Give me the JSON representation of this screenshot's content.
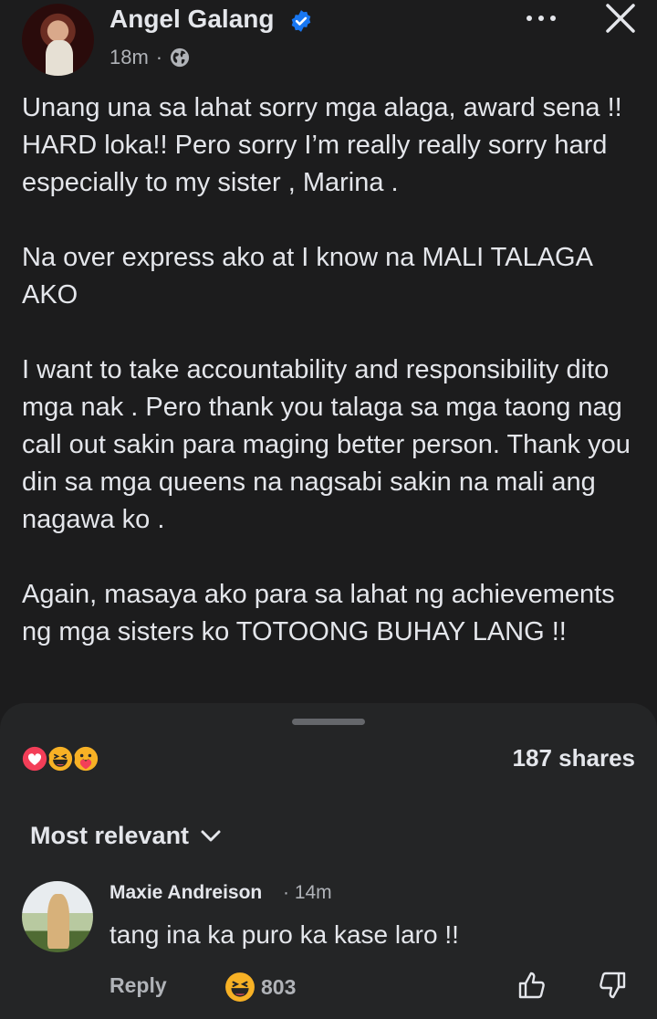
{
  "post": {
    "author": "Angel Galang",
    "time": "18m",
    "separator": "·",
    "paragraphs": [
      "Unang una sa lahat sorry mga alaga, award sena !! HARD loka!! Pero sorry I’m really really sorry hard especially to my sister , Marina .",
      "Na over express ako at I know na MALI TALAGA AKO",
      "I want to take accountability and responsibility dito mga nak . Pero thank you talaga sa mga taong nag call out sakin para maging better person. Thank you din sa mga queens na nagsabi sakin na mali ang nagawa ko .",
      "Again, masaya ako para sa lahat ng achievements ng mga sisters ko TOTOONG BUHAY LANG !!"
    ]
  },
  "icons": {
    "verified": "verified-badge-icon",
    "globe": "globe-icon",
    "more": "more-icon",
    "close": "close-icon",
    "reactions": [
      "heart-reaction",
      "haha-reaction",
      "care-reaction"
    ],
    "like": "thumbs-up-icon",
    "dislike": "thumbs-down-icon",
    "chevron": "chevron-down-icon"
  },
  "colors": {
    "background": "#1c1c1d",
    "sheet": "#242526",
    "verified_blue": "#1877f2",
    "heart": "#f33e58",
    "emoji_yellow": "#f7b125"
  },
  "engagement": {
    "shares": "187 shares"
  },
  "comments_section": {
    "sort_label": "Most relevant",
    "comments": [
      {
        "author": "Maxie Andreison",
        "time": "· 14m",
        "text": "tang ina ka puro ka kase laro !!",
        "reply_label": "Reply",
        "reaction_count": "803"
      }
    ]
  }
}
